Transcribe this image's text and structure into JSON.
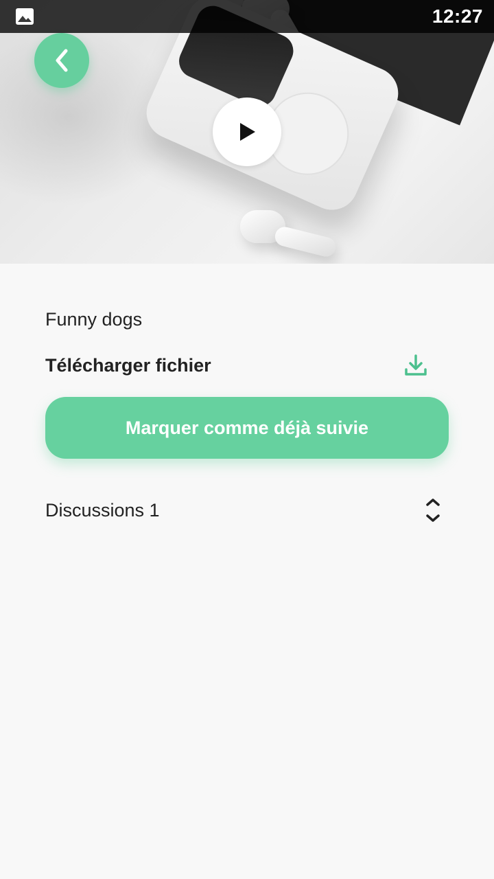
{
  "status_bar": {
    "time": "12:27"
  },
  "media": {
    "play_icon": "play-icon",
    "back_icon": "chevron-left-icon"
  },
  "content": {
    "title": "Funny dogs",
    "download_label": "Télécharger fichier",
    "mark_button_label": "Marquer comme déjà suivie",
    "discussions_label": "Discussions 1"
  },
  "colors": {
    "accent": "#66cf9e",
    "text": "#222222",
    "background": "#f8f8f8"
  }
}
